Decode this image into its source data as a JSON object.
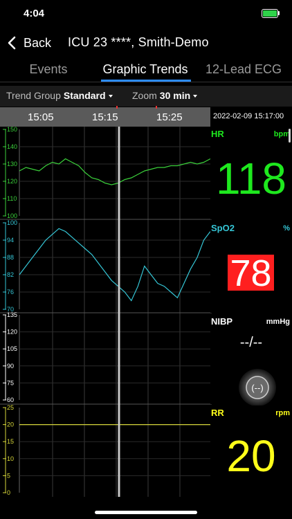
{
  "status_bar": {
    "time": "4:04"
  },
  "nav": {
    "back_label": "Back",
    "title": "ICU 23 ****, Smith-Demo"
  },
  "tabs": [
    {
      "label": "Events",
      "active": false
    },
    {
      "label": "Graphic Trends",
      "active": true
    },
    {
      "label": "12-Lead ECG",
      "active": false
    }
  ],
  "toolbar": {
    "trend_group_label": "Trend Group",
    "trend_group_value": "Standard",
    "zoom_label": "Zoom",
    "zoom_value": "30 min"
  },
  "time_axis": {
    "labels": [
      "15:05",
      "15:15",
      "15:25"
    ],
    "cursor_timestamp": "2022-02-09  15:17:00"
  },
  "chart_data": [
    {
      "type": "line",
      "name": "HR",
      "color": "#3bd13b",
      "ylim": [
        100,
        150
      ],
      "yticks": [
        "150",
        "140",
        "130",
        "120",
        "110",
        "100"
      ],
      "x_minutes": [
        0,
        1,
        2,
        3,
        4,
        5,
        6,
        7,
        8,
        9,
        10,
        11,
        12,
        13,
        14,
        15,
        16,
        17,
        18,
        19,
        20,
        21,
        22,
        23,
        24,
        25,
        26,
        27,
        28,
        29
      ],
      "values": [
        126,
        128,
        127,
        126,
        129,
        131,
        130,
        133,
        131,
        129,
        125,
        122,
        121,
        119,
        118,
        119,
        121,
        122,
        124,
        126,
        127,
        128,
        128,
        129,
        129,
        130,
        131,
        130,
        131,
        133
      ]
    },
    {
      "type": "line",
      "name": "SpO2",
      "color": "#35c6d6",
      "ylim": [
        70,
        100
      ],
      "yticks": [
        "100",
        "94",
        "88",
        "82",
        "76",
        "70"
      ],
      "x_minutes": [
        0,
        1,
        2,
        3,
        4,
        5,
        6,
        7,
        8,
        9,
        10,
        11,
        12,
        13,
        14,
        15,
        16,
        17,
        18,
        19,
        20,
        21,
        22,
        23,
        24,
        25,
        26,
        27,
        28,
        29
      ],
      "values": [
        82,
        85,
        88,
        91,
        94,
        96,
        98,
        97,
        95,
        93,
        91,
        89,
        86,
        83,
        80,
        78,
        76,
        73,
        78,
        85,
        82,
        79,
        78,
        76,
        74,
        79,
        84,
        88,
        94,
        97
      ]
    },
    {
      "type": "line",
      "name": "NIBP",
      "ylim": [
        60,
        135
      ],
      "yticks": [
        "135",
        "120",
        "105",
        "90",
        "75",
        "60"
      ],
      "values": []
    },
    {
      "type": "line",
      "name": "RR",
      "color": "#d8d83a",
      "ylim": [
        0,
        25
      ],
      "yticks": [
        "25",
        "20",
        "15",
        "10",
        "5",
        "0"
      ],
      "x_minutes": [
        0,
        29
      ],
      "values": [
        20,
        20
      ]
    }
  ],
  "panels": {
    "hr": {
      "name": "HR",
      "unit": "bpm",
      "value": "118",
      "color": "#1ee81e"
    },
    "spo2": {
      "name": "SpO2",
      "unit": "%",
      "value": "78",
      "color": "#35c6d6",
      "alarm_color": "#ff1f1f"
    },
    "nibp": {
      "name": "NIBP",
      "unit": "mmHg",
      "value": "--/--",
      "icon_text": "(--)",
      "color": "#ffffff"
    },
    "rr": {
      "name": "RR",
      "unit": "rpm",
      "value": "20",
      "color": "#ffff1a"
    }
  }
}
